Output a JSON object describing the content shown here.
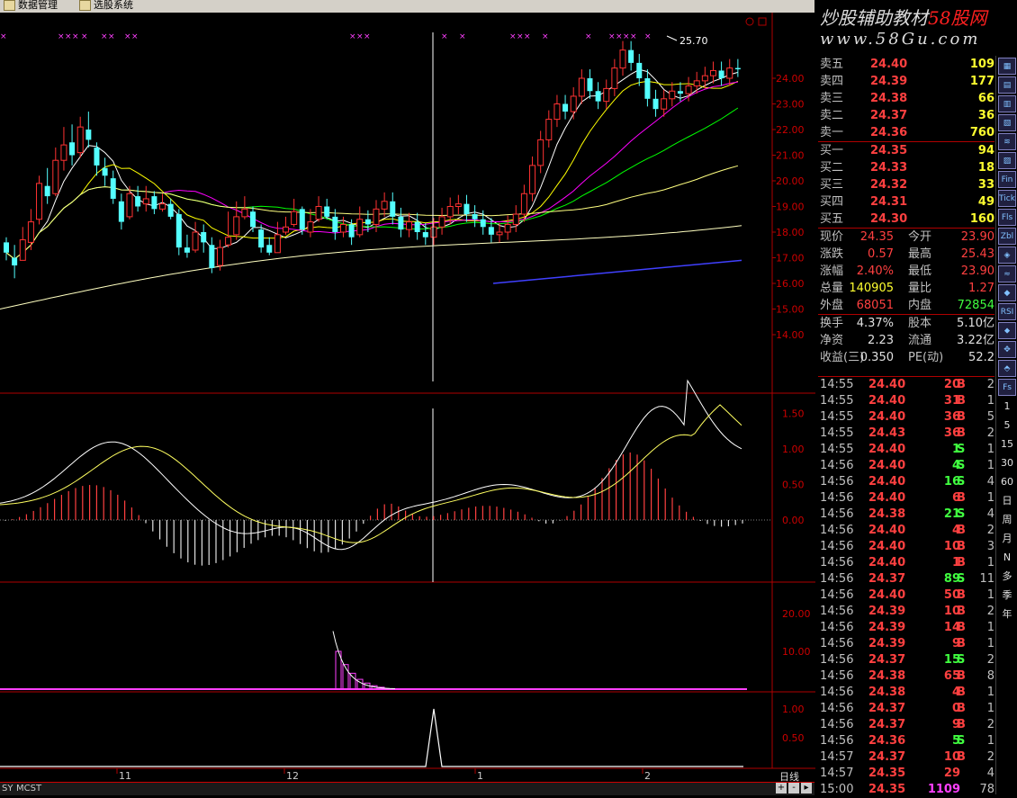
{
  "menu": {
    "items": [
      {
        "label": "数据管理"
      },
      {
        "label": "选股系统"
      }
    ]
  },
  "brand": {
    "title_a": "炒股辅助教材",
    "title_b": "58股网",
    "url": "www.58Gu.com"
  },
  "chart": {
    "high_label": "25.70",
    "price_axis": [
      "24.00",
      "23.00",
      "22.00",
      "21.00",
      "20.00",
      "19.00",
      "18.00",
      "17.00",
      "16.00",
      "15.00",
      "14.00"
    ],
    "macd_axis": [
      "1.50",
      "1.00",
      "0.50",
      "0.00"
    ],
    "ind2_axis": [
      "20.00",
      "10.00"
    ],
    "ind3_axis": [
      "1.00",
      "0.50"
    ],
    "x_labels": [
      "11",
      "12",
      "1",
      "2"
    ],
    "period": "日线",
    "tabs": [
      "SY",
      "MCST"
    ],
    "colors": {
      "up": "#ff3232",
      "down": "#54ffff",
      "ma5": "#ffffff",
      "ma10": "#ffff00",
      "ma20": "#ff00ff",
      "ma30": "#00ff00",
      "ma60": "#ffff80",
      "ma120": "#ffffc0",
      "ma250": "#4040ff"
    }
  },
  "quote": {
    "ask": [
      {
        "label": "卖五",
        "price": "24.40",
        "vol": "109"
      },
      {
        "label": "卖四",
        "price": "24.39",
        "vol": "177"
      },
      {
        "label": "卖三",
        "price": "24.38",
        "vol": "66"
      },
      {
        "label": "卖二",
        "price": "24.37",
        "vol": "36"
      },
      {
        "label": "卖一",
        "price": "24.36",
        "vol": "760"
      }
    ],
    "bid": [
      {
        "label": "买一",
        "price": "24.35",
        "vol": "94"
      },
      {
        "label": "买二",
        "price": "24.33",
        "vol": "18"
      },
      {
        "label": "买三",
        "price": "24.32",
        "vol": "33"
      },
      {
        "label": "买四",
        "price": "24.31",
        "vol": "49"
      },
      {
        "label": "买五",
        "price": "24.30",
        "vol": "160"
      }
    ],
    "stats": [
      {
        "l1": "现价",
        "v1": "24.35",
        "c1": "#ff4040",
        "l2": "今开",
        "v2": "23.90",
        "c2": "#ff4040"
      },
      {
        "l1": "涨跌",
        "v1": "0.57",
        "c1": "#ff4040",
        "l2": "最高",
        "v2": "25.43",
        "c2": "#ff4040"
      },
      {
        "l1": "涨幅",
        "v1": "2.40%",
        "c1": "#ff4040",
        "l2": "最低",
        "v2": "23.90",
        "c2": "#ff4040"
      },
      {
        "l1": "总量",
        "v1": "140905",
        "c1": "#ffff30",
        "l2": "量比",
        "v2": "1.27",
        "c2": "#ff4040"
      },
      {
        "l1": "外盘",
        "v1": "68051",
        "c1": "#ff4040",
        "l2": "内盘",
        "v2": "72854",
        "c2": "#40ff40"
      },
      {
        "l1": "换手",
        "v1": "4.37%",
        "c1": "#e0e0e0",
        "l2": "股本",
        "v2": "5.10亿",
        "c2": "#e0e0e0"
      },
      {
        "l1": "净资",
        "v1": "2.23",
        "c1": "#e0e0e0",
        "l2": "流通",
        "v2": "3.22亿",
        "c2": "#e0e0e0"
      },
      {
        "l1": "收益(三)",
        "v1": "0.350",
        "c1": "#e0e0e0",
        "l2": "PE(动)",
        "v2": "52.2",
        "c2": "#e0e0e0"
      }
    ]
  },
  "trades": [
    {
      "time": "14:55",
      "price": "24.40",
      "vol": "20",
      "dir": "B",
      "n": "2"
    },
    {
      "time": "14:55",
      "price": "24.40",
      "vol": "31",
      "dir": "B",
      "n": "1"
    },
    {
      "time": "14:55",
      "price": "24.40",
      "vol": "36",
      "dir": "B",
      "n": "5"
    },
    {
      "time": "14:55",
      "price": "24.43",
      "vol": "36",
      "dir": "B",
      "n": "2"
    },
    {
      "time": "14:55",
      "price": "24.40",
      "vol": "1",
      "dir": "S",
      "n": "1"
    },
    {
      "time": "14:56",
      "price": "24.40",
      "vol": "4",
      "dir": "S",
      "n": "1"
    },
    {
      "time": "14:56",
      "price": "24.40",
      "vol": "16",
      "dir": "S",
      "n": "4"
    },
    {
      "time": "14:56",
      "price": "24.40",
      "vol": "6",
      "dir": "B",
      "n": "1"
    },
    {
      "time": "14:56",
      "price": "24.38",
      "vol": "21",
      "dir": "S",
      "n": "4"
    },
    {
      "time": "14:56",
      "price": "24.40",
      "vol": "4",
      "dir": "B",
      "n": "2"
    },
    {
      "time": "14:56",
      "price": "24.40",
      "vol": "10",
      "dir": "B",
      "n": "3"
    },
    {
      "time": "14:56",
      "price": "24.40",
      "vol": "1",
      "dir": "B",
      "n": "1"
    },
    {
      "time": "14:56",
      "price": "24.37",
      "vol": "89",
      "dir": "S",
      "n": "11"
    },
    {
      "time": "14:56",
      "price": "24.40",
      "vol": "50",
      "dir": "B",
      "n": "1"
    },
    {
      "time": "14:56",
      "price": "24.39",
      "vol": "10",
      "dir": "B",
      "n": "2"
    },
    {
      "time": "14:56",
      "price": "24.39",
      "vol": "14",
      "dir": "B",
      "n": "1"
    },
    {
      "time": "14:56",
      "price": "24.39",
      "vol": "9",
      "dir": "B",
      "n": "1"
    },
    {
      "time": "14:56",
      "price": "24.37",
      "vol": "15",
      "dir": "S",
      "n": "2"
    },
    {
      "time": "14:56",
      "price": "24.38",
      "vol": "65",
      "dir": "B",
      "n": "8"
    },
    {
      "time": "14:56",
      "price": "24.38",
      "vol": "4",
      "dir": "B",
      "n": "1"
    },
    {
      "time": "14:56",
      "price": "24.37",
      "vol": "0",
      "dir": "B",
      "n": "1"
    },
    {
      "time": "14:56",
      "price": "24.37",
      "vol": "9",
      "dir": "B",
      "n": "2"
    },
    {
      "time": "14:56",
      "price": "24.36",
      "vol": "5",
      "dir": "S",
      "n": "1"
    },
    {
      "time": "14:57",
      "price": "24.37",
      "vol": "10",
      "dir": "B",
      "n": "2"
    },
    {
      "time": "14:57",
      "price": "24.35",
      "vol": "29",
      "dir": "",
      "n": "4"
    },
    {
      "time": "15:00",
      "price": "24.35",
      "vol": "1109",
      "dir": "",
      "n": "78"
    }
  ],
  "sidebar": {
    "icon_buttons": [
      "chart-1-icon",
      "chart-2-icon",
      "chart-3-icon",
      "chart-4-icon",
      "chart-5-icon",
      "chart-6-icon"
    ],
    "labels": [
      "Fin",
      "Tick",
      "Fls",
      "Zbl",
      "",
      "",
      "",
      "RSI",
      "",
      "",
      "",
      "Fs",
      "1",
      "5",
      "15",
      "30",
      "60",
      "日",
      "周",
      "月",
      "N",
      "多",
      "季",
      "年"
    ]
  },
  "candles": [
    [
      17.6,
      17.2,
      17.8,
      16.9
    ],
    [
      17.0,
      16.7,
      17.5,
      16.2
    ],
    [
      16.9,
      17.7,
      18.2,
      16.9
    ],
    [
      17.6,
      18.4,
      18.9,
      17.3
    ],
    [
      18.5,
      19.9,
      20.2,
      18.3
    ],
    [
      19.8,
      19.4,
      20.5,
      19.1
    ],
    [
      19.5,
      20.8,
      21.3,
      19.4
    ],
    [
      20.8,
      21.4,
      22.1,
      20.4
    ],
    [
      21.5,
      21.0,
      22.2,
      20.6
    ],
    [
      21.1,
      22.1,
      22.5,
      20.9
    ],
    [
      22.0,
      21.6,
      22.7,
      21.3
    ],
    [
      21.3,
      20.6,
      21.5,
      20.2
    ],
    [
      20.5,
      20.2,
      20.9,
      19.8
    ],
    [
      20.1,
      19.3,
      20.4,
      19.1
    ],
    [
      19.2,
      18.4,
      19.5,
      18.1
    ],
    [
      18.6,
      19.5,
      19.8,
      18.5
    ],
    [
      19.4,
      19.0,
      19.8,
      18.8
    ],
    [
      19.1,
      19.3,
      19.8,
      18.8
    ],
    [
      19.4,
      18.9,
      19.6,
      18.7
    ],
    [
      18.9,
      19.1,
      19.5,
      18.8
    ],
    [
      19.1,
      18.6,
      19.3,
      18.5
    ],
    [
      18.7,
      17.4,
      18.9,
      17.1
    ],
    [
      17.4,
      17.2,
      17.9,
      17.0
    ],
    [
      17.3,
      18.0,
      18.4,
      17.2
    ],
    [
      18.0,
      17.6,
      18.3,
      17.2
    ],
    [
      17.5,
      16.6,
      17.8,
      16.4
    ],
    [
      16.7,
      17.4,
      17.7,
      16.5
    ],
    [
      17.5,
      17.8,
      18.8,
      17.4
    ],
    [
      17.9,
      18.6,
      19.2,
      17.7
    ],
    [
      18.6,
      18.9,
      19.4,
      18.5
    ],
    [
      18.8,
      18.2,
      19.0,
      18.0
    ],
    [
      18.1,
      17.4,
      18.3,
      17.2
    ],
    [
      17.5,
      17.2,
      17.8,
      17.1
    ],
    [
      17.2,
      17.9,
      18.4,
      17.2
    ],
    [
      18.0,
      18.2,
      18.6,
      17.9
    ],
    [
      18.3,
      18.8,
      19.3,
      18.2
    ],
    [
      18.9,
      18.1,
      19.0,
      17.9
    ],
    [
      18.0,
      18.4,
      18.9,
      17.8
    ],
    [
      18.5,
      19.0,
      19.4,
      18.4
    ],
    [
      19.0,
      18.6,
      19.3,
      18.5
    ],
    [
      18.6,
      18.0,
      18.9,
      17.7
    ],
    [
      18.0,
      18.3,
      18.6,
      17.8
    ],
    [
      18.3,
      17.8,
      18.5,
      17.5
    ],
    [
      17.9,
      18.5,
      19.0,
      17.8
    ]
  ]
}
